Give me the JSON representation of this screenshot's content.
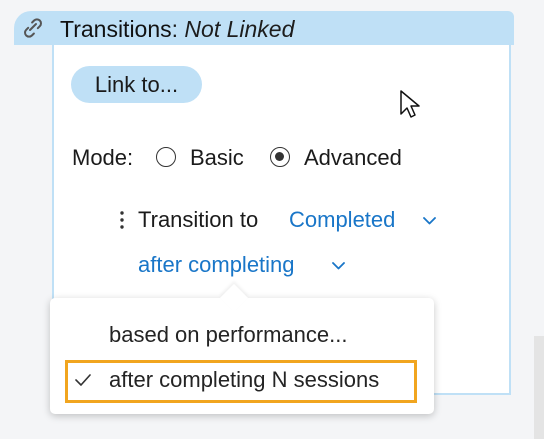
{
  "header": {
    "title_strong": "Transitions",
    "title_separator": ": ",
    "title_state": "Not Linked"
  },
  "actions": {
    "link_button": "Link to..."
  },
  "mode": {
    "label": "Mode:",
    "options": [
      "Basic",
      "Advanced"
    ],
    "selected": "Advanced"
  },
  "transition": {
    "label": "Transition to",
    "target": "Completed"
  },
  "condition": {
    "selected_label": "after completing"
  },
  "dropdown": {
    "options": [
      {
        "label": "based on performance...",
        "checked": false
      },
      {
        "label": "after completing N sessions",
        "checked": true
      }
    ]
  },
  "icons": {
    "header": "link-icon",
    "drag": "drag-handle-icon",
    "dropdown": "chevron-down-icon",
    "check": "check-icon",
    "cursor": "mouse-pointer-icon"
  },
  "colors": {
    "header_background": "#bfe0f6",
    "link_blue": "#1976c8",
    "highlight_orange": "#f1a51f",
    "panel_background": "#ffffff"
  }
}
